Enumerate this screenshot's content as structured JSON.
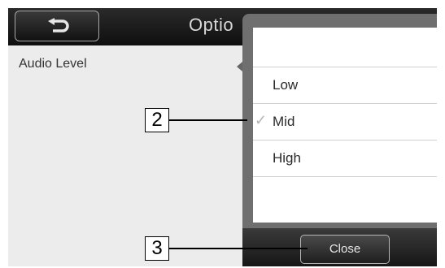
{
  "header": {
    "title": "Optio",
    "back_icon": "return-arrow-icon"
  },
  "main": {
    "audio_level_label": "Audio Level"
  },
  "popup": {
    "items": [
      {
        "label": "",
        "selected": false
      },
      {
        "label": "Low",
        "selected": false
      },
      {
        "label": "Mid",
        "selected": true
      },
      {
        "label": "High",
        "selected": false
      },
      {
        "label": "",
        "selected": false
      }
    ],
    "check_mark": "✓",
    "close_label": "Close"
  },
  "callouts": {
    "item_callout": "2",
    "close_callout": "3"
  }
}
